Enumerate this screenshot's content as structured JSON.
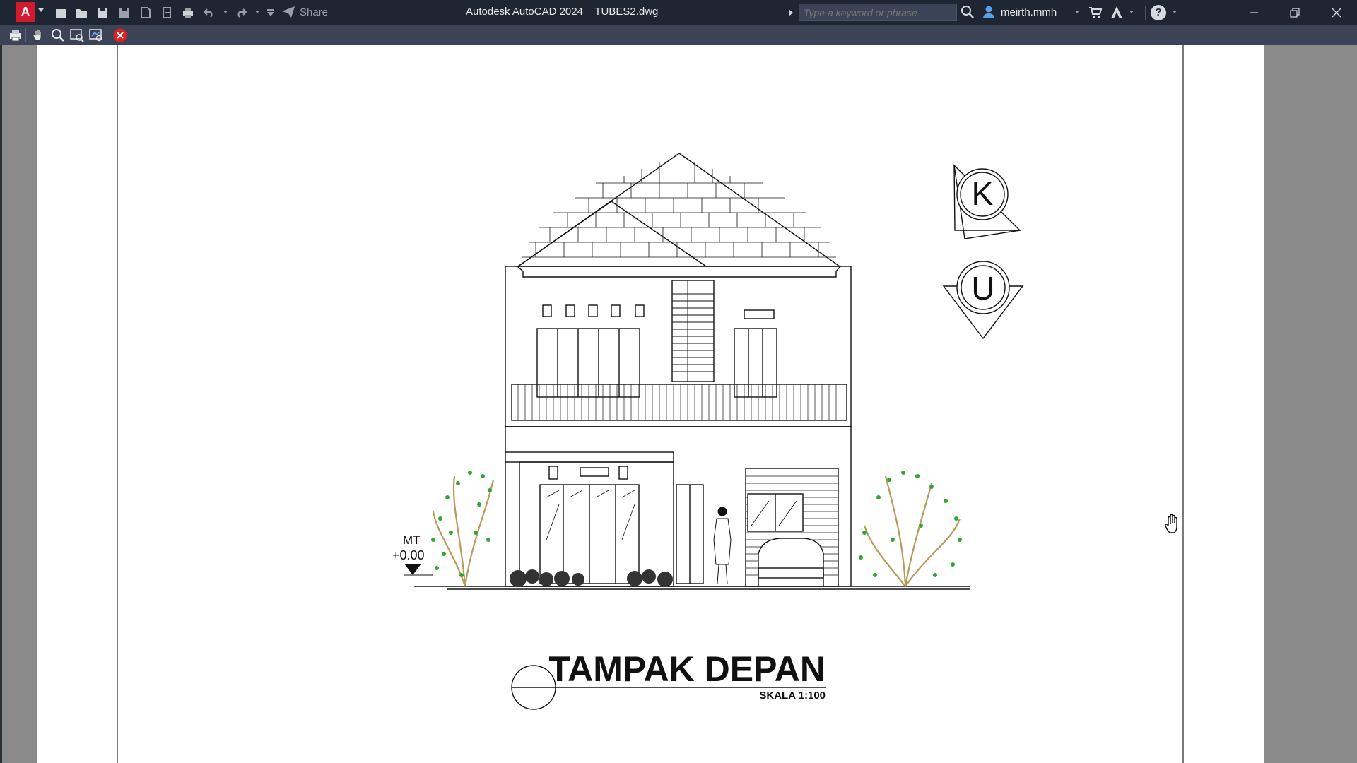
{
  "app": {
    "title": "Autodesk AutoCAD 2024    TUBES2.dwg",
    "logo_letter": "A",
    "share_label": "Share",
    "search_placeholder": "Type a keyword or phrase",
    "username": "meirth.mmh",
    "help_symbol": "?"
  },
  "quick_access": [
    "new-icon",
    "open-icon",
    "save-icon",
    "save-as-icon",
    "publish-icon",
    "import-icon",
    "plot-icon",
    "undo-icon",
    "redo-icon",
    "customize-icon"
  ],
  "preview_toolbar": [
    "print-icon",
    "pan-icon",
    "zoom-icon",
    "zoom-window-icon",
    "zoom-original-icon",
    "close-preview-icon"
  ],
  "drawing": {
    "title": "TAMPAK DEPAN",
    "scale": "SKALA 1:100",
    "level_label": "MT",
    "level_value": "+0.00",
    "north_labels": [
      "K",
      "U"
    ]
  },
  "colors": {
    "titlebar": "#1e2533",
    "toolbar": "#3b4456",
    "close_preview": "#e02020",
    "tree_trunk": "#b89a5a",
    "tree_leaves": "#2fa82f"
  }
}
